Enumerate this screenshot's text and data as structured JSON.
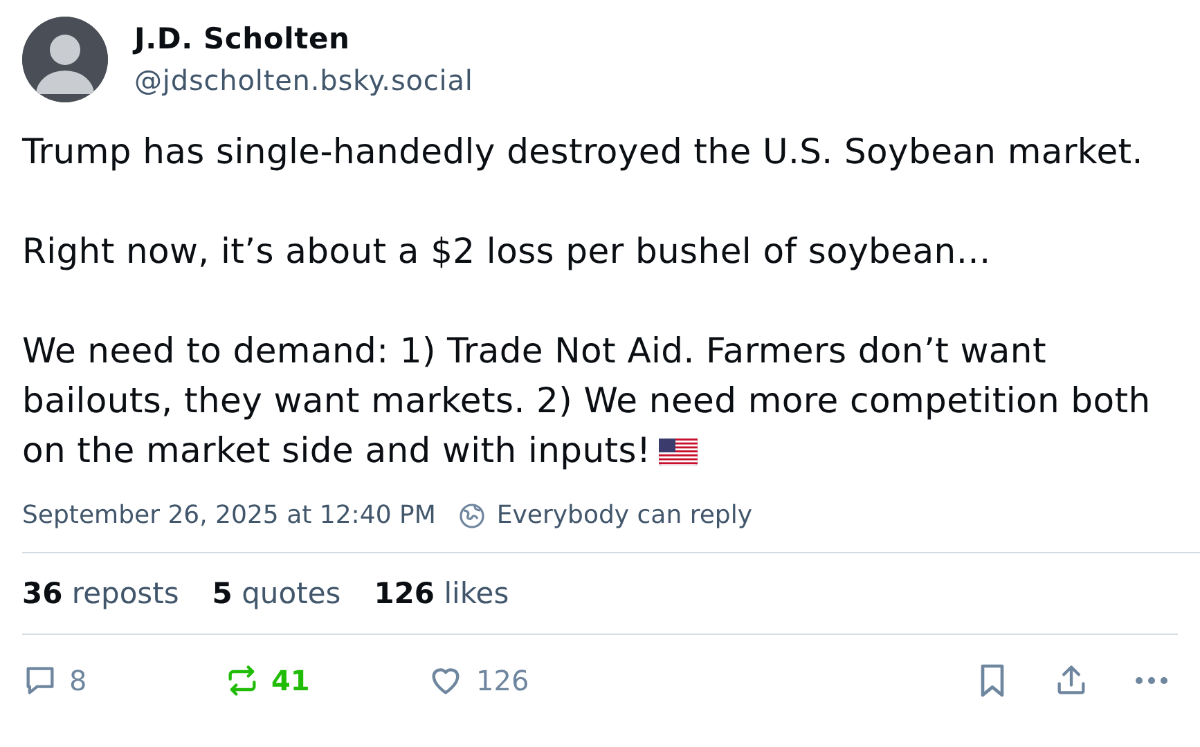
{
  "author": {
    "name": "J.D. Scholten",
    "handle": "@jdscholten.bsky.social"
  },
  "paragraphs": [
    "Trump has single-handedly destroyed the U.S. Soybean market.",
    "Right now, it’s about a $2 loss per bushel of soybean…",
    "We need to demand: 1) Trade Not Aid. Farmers don’t want bailouts, they want markets. 2) We need more competition both on the market side and with inputs!"
  ],
  "timestamp": "September 26, 2025 at 12:40 PM",
  "reply_setting": "Everybody can reply",
  "stats": [
    "**36** reposts",
    "**5** quotes",
    "**126** likes"
  ],
  "actions": [
    {
      "kind": "reply",
      "count": "8"
    },
    {
      "kind": "repost",
      "count": "41",
      "active": true
    },
    {
      "kind": "like",
      "count": "126",
      "active": false
    },
    {
      "kind": "bookmark",
      "active": false
    },
    {
      "kind": "share"
    },
    {
      "kind": "more"
    }
  ]
}
